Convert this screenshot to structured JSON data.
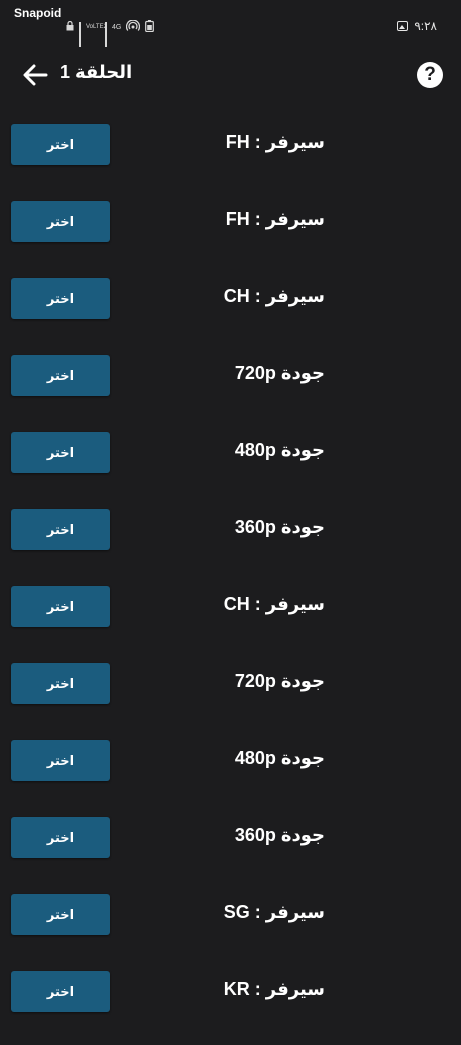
{
  "status_bar": {
    "app_label": "Snapoid",
    "network_volte": "VoLTE2",
    "network_type": "4G",
    "time": "٩:٢٨"
  },
  "app_bar": {
    "title": "الحلقة 1",
    "back_icon": "arrow-back-icon",
    "help_icon": "help-circle-icon"
  },
  "button_label": "اختر",
  "items": [
    {
      "label": "FH",
      "prefix": "سيرفر :"
    },
    {
      "label": "FH",
      "prefix": "سيرفر :"
    },
    {
      "label": "CH",
      "prefix": "سيرفر :"
    },
    {
      "label": "720p",
      "prefix": "جودة"
    },
    {
      "label": "480p",
      "prefix": "جودة"
    },
    {
      "label": "360p",
      "prefix": "جودة"
    },
    {
      "label": "CH",
      "prefix": "سيرفر :"
    },
    {
      "label": "720p",
      "prefix": "جودة"
    },
    {
      "label": "480p",
      "prefix": "جودة"
    },
    {
      "label": "360p",
      "prefix": "جودة"
    },
    {
      "label": "SG",
      "prefix": "سيرفر :"
    },
    {
      "label": "KR",
      "prefix": "سيرفر :"
    }
  ],
  "colors": {
    "background": "#1c1c1e",
    "button": "#1b5c7e",
    "text": "#ffffff"
  }
}
